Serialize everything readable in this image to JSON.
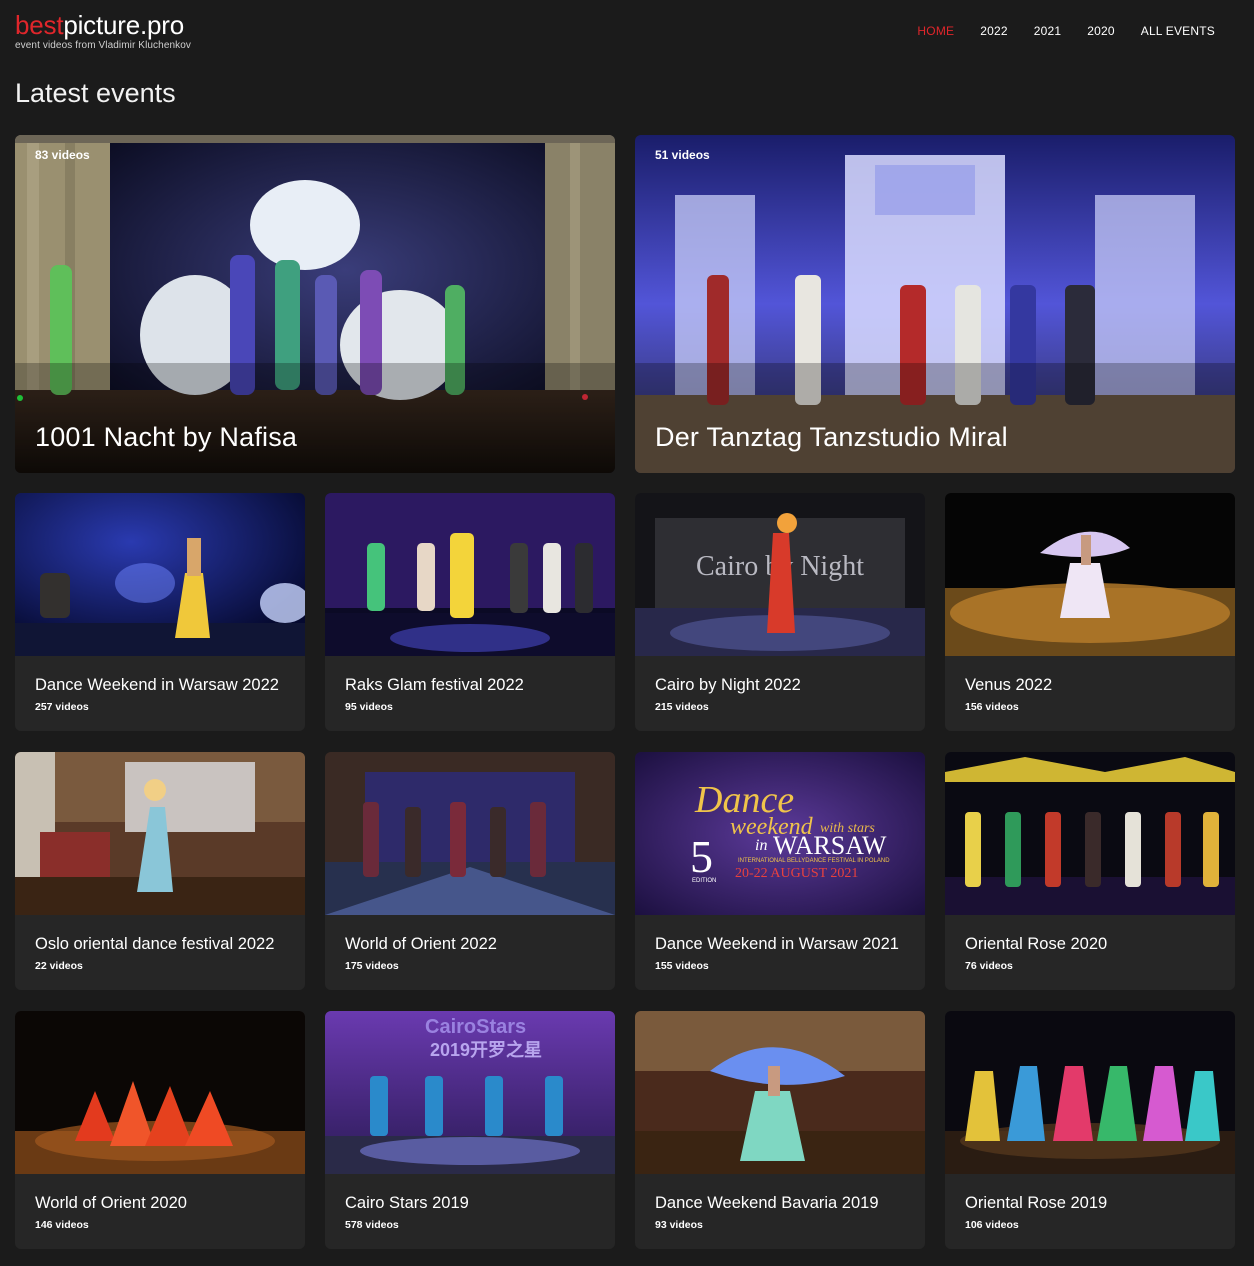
{
  "site": {
    "logo_red": "best",
    "logo_white": "picture.pro",
    "tagline": "event videos from Vladimir Kluchenkov"
  },
  "nav": [
    {
      "label": "HOME",
      "active": true
    },
    {
      "label": "2022",
      "active": false
    },
    {
      "label": "2021",
      "active": false
    },
    {
      "label": "2020",
      "active": false
    },
    {
      "label": "ALL EVENTS",
      "active": false
    }
  ],
  "page_title": "Latest events",
  "featured": [
    {
      "title": "1001 Nacht by Nafisa",
      "count": "83 videos"
    },
    {
      "title": "Der Tanztag Tanzstudio Miral",
      "count": "51 videos"
    }
  ],
  "events": [
    {
      "title": "Dance Weekend in Warsaw 2022",
      "count": "257 videos"
    },
    {
      "title": "Raks Glam festival 2022",
      "count": "95 videos"
    },
    {
      "title": "Cairo by Night 2022",
      "count": "215 videos"
    },
    {
      "title": "Venus 2022",
      "count": "156 videos"
    },
    {
      "title": "Oslo oriental dance festival 2022",
      "count": "22 videos"
    },
    {
      "title": "World of Orient 2022",
      "count": "175 videos"
    },
    {
      "title": "Dance Weekend in Warsaw 2021",
      "count": "155 videos"
    },
    {
      "title": "Oriental Rose 2020",
      "count": "76 videos"
    },
    {
      "title": "World of Orient 2020",
      "count": "146 videos"
    },
    {
      "title": "Cairo Stars 2019",
      "count": "578 videos"
    },
    {
      "title": "Dance Weekend Bavaria 2019",
      "count": "93 videos"
    },
    {
      "title": "Oriental Rose 2019",
      "count": "106 videos"
    }
  ],
  "thumb_text": {
    "cairo_banner": "Cairo by Night",
    "warsaw_dance": "Dance",
    "warsaw_weekend": "weekend",
    "warsaw_with_stars": "with stars",
    "warsaw_five": "5",
    "warsaw_edition": "EDITION",
    "warsaw_in": "in",
    "warsaw_city": "WARSAW",
    "warsaw_festival": "INTERNATIONAL BELLYDANCE FESTIVAL IN POLAND",
    "warsaw_dates": "20-22 AUGUST 2021",
    "cairostars_banner": "CairoStars",
    "cairostars_year": "2019开罗之星"
  },
  "colors": {
    "accent": "#e0262b",
    "background": "#1b1b1b",
    "card": "#262626"
  }
}
